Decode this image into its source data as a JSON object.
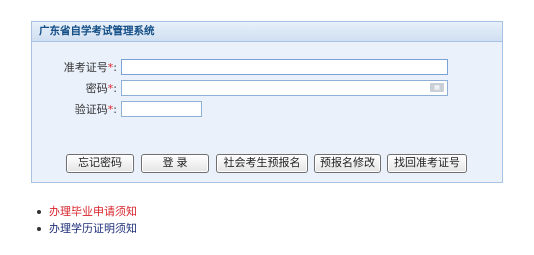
{
  "panel": {
    "title": "广东省自学考试管理系统"
  },
  "form": {
    "exam_no_label": "准考证号",
    "password_label": "密码",
    "captcha_label": "验证码",
    "required_mark": "*",
    "colon": ":",
    "exam_no_value": "",
    "password_value": "",
    "captcha_value": ""
  },
  "buttons": {
    "forgot_password": "忘记密码",
    "login": "登 录",
    "social_prereg": "社会考生预报名",
    "prereg_modify": "预报名修改",
    "retrieve_exam_no": "找回准考证号"
  },
  "links": [
    {
      "label": "办理毕业申请须知",
      "color": "#d9232a"
    },
    {
      "label": "办理学历证明须知",
      "color": "#1f2f7a"
    }
  ],
  "colors": {
    "panel_border": "#a6c3e2",
    "panel_bg": "#eaf1fb",
    "header_text": "#134e86",
    "required": "#e0282a"
  },
  "icons": {
    "keyboard": "keyboard-icon"
  }
}
